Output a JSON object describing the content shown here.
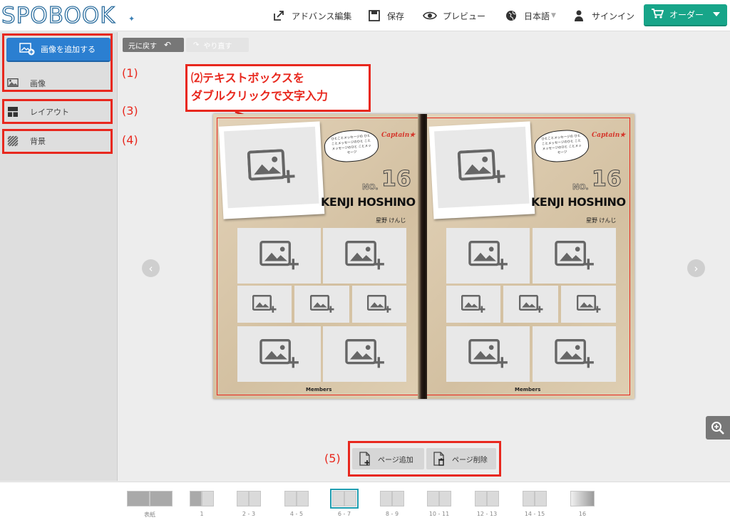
{
  "header": {
    "logo": "SPOBOOK",
    "advanced_edit": "アドバンス編集",
    "save": "保存",
    "preview": "プレビュー",
    "language": "日本語",
    "signin": "サインイン",
    "order": "オーダー"
  },
  "sidebar": {
    "add_image": "画像を追加する",
    "items": [
      {
        "label": "画像"
      },
      {
        "label": "レイアウト"
      },
      {
        "label": "背景"
      }
    ]
  },
  "annotations": {
    "n1": "(1)",
    "n3": "(3)",
    "n4": "(4)",
    "n5": "(5)",
    "callout_line1": "⑵テキストボックスを",
    "callout_line2": "ダブルクリックで文字入力"
  },
  "toolbar": {
    "undo": "元に戻す",
    "redo": "やり直す"
  },
  "spread": {
    "captain": "Captain★",
    "no": "NO.",
    "number": "16",
    "name": "KENJI HOSHINO",
    "kana": "星野 けんじ",
    "members": "Members",
    "bubble": "ひとことメッセージの ひとことメッセージのひと ことメッセージのひと ことメッセージ"
  },
  "page_buttons": {
    "add": "ページ追加",
    "delete": "ページ削除"
  },
  "thumbnails": [
    {
      "label": "表紙"
    },
    {
      "label": "1"
    },
    {
      "label": "2 - 3"
    },
    {
      "label": "4 - 5"
    },
    {
      "label": "6 - 7"
    },
    {
      "label": "8 - 9"
    },
    {
      "label": "10 - 11"
    },
    {
      "label": "12 - 13"
    },
    {
      "label": "14 - 15"
    },
    {
      "label": "16"
    }
  ],
  "colors": {
    "accent_red": "#e8281e",
    "order_green": "#17a589",
    "add_blue": "#2b7fd1"
  }
}
